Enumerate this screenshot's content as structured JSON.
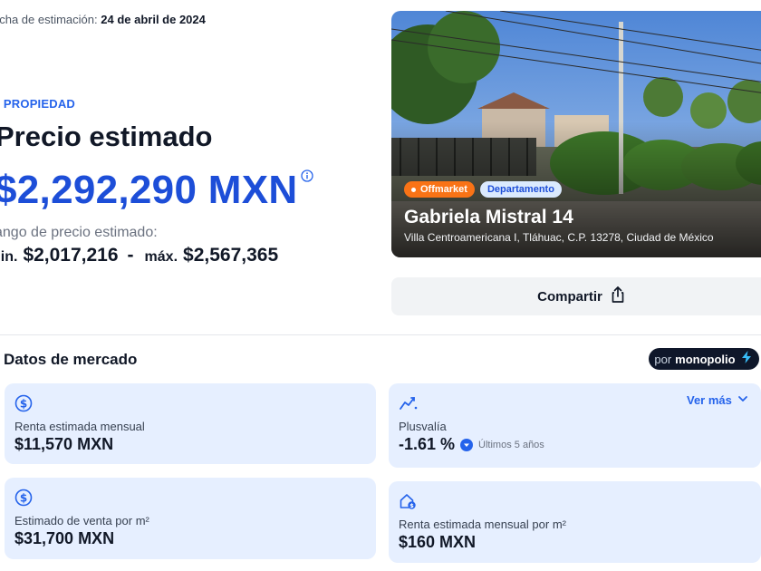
{
  "estimate": {
    "date_label": "echa de estimación:",
    "date_value": "24 de abril de 2024",
    "kicker": "A PROPIEDAD",
    "title": "Precio estimado",
    "price": "$2,292,290 MXN",
    "range_label": "ango de precio estimado:",
    "min_label": "nin.",
    "min_value": "$2,017,216",
    "separator": "-",
    "max_label": "máx.",
    "max_value": "$2,567,365"
  },
  "property": {
    "badge_status": "Offmarket",
    "badge_type": "Departamento",
    "name": "Gabriela Mistral 14",
    "address": "Villa Centroamericana I, Tláhuac, C.P. 13278, Ciudad de México"
  },
  "share": {
    "label": "Compartir"
  },
  "market": {
    "title": "Datos de mercado",
    "powered_prefix": "por",
    "powered_brand": "monopolio",
    "rent": {
      "label": "Renta estimada mensual",
      "value": "$11,570 MXN",
      "icon": "dollar-circle-icon"
    },
    "plusvalia": {
      "label": "Plusvalía",
      "value": "-1.61 %",
      "period": "Últimos 5 años",
      "ver_mas": "Ver más",
      "icon": "trend-chart-icon"
    },
    "sale_m2": {
      "label": "Estimado de venta por m²",
      "value": "$31,700 MXN",
      "icon": "dollar-circle-icon"
    },
    "rent_m2": {
      "label": "Renta estimada mensual por m²",
      "value": "$160 MXN",
      "icon": "house-dollar-icon"
    }
  },
  "colors": {
    "accent": "#2563eb",
    "price": "#1d4ed8",
    "card_bg": "#e6efff",
    "offmarket": "#f97316"
  }
}
